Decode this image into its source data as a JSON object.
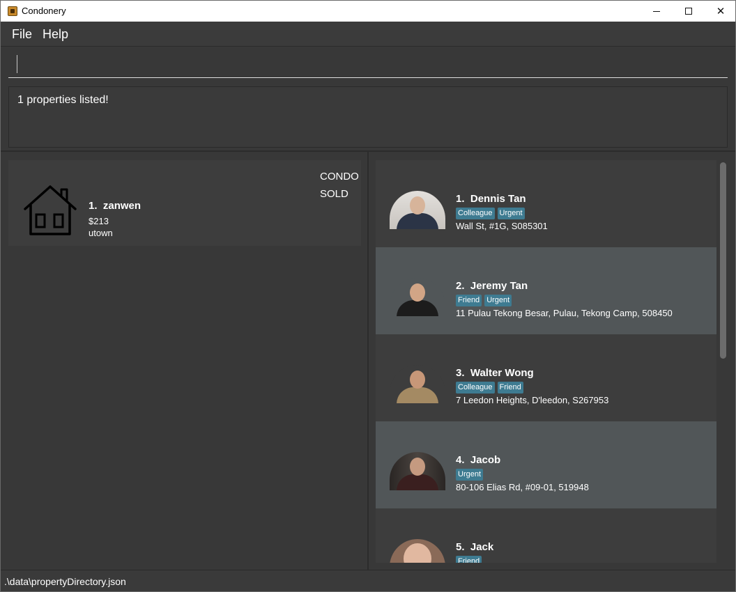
{
  "window": {
    "title": "Condonery",
    "controls": {
      "minimize": "–",
      "maximize": "□",
      "close": "✕"
    }
  },
  "menu": {
    "file": "File",
    "help": "Help"
  },
  "command": {
    "value": ""
  },
  "result": {
    "message": "1 properties listed!"
  },
  "properties": [
    {
      "index": "1.",
      "name": "zanwen",
      "price": "$213",
      "address": "utown",
      "type": "CONDO",
      "status": "SOLD",
      "icon": "house-icon"
    }
  ],
  "persons": [
    {
      "index": "1.",
      "name": "Dennis Tan",
      "tags": [
        "Colleague",
        "Urgent"
      ],
      "address": "Wall St, #1G, S085301"
    },
    {
      "index": "2.",
      "name": "Jeremy Tan",
      "tags": [
        "Friend",
        "Urgent"
      ],
      "address": "11 Pulau Tekong Besar, Pulau, Tekong Camp, 508450"
    },
    {
      "index": "3.",
      "name": "Walter Wong",
      "tags": [
        "Colleague",
        "Friend"
      ],
      "address": "7 Leedon Heights, D'leedon, S267953"
    },
    {
      "index": "4.",
      "name": "Jacob",
      "tags": [
        "Urgent"
      ],
      "address": "80-106 Elias Rd, #09-01, 519948"
    },
    {
      "index": "5.",
      "name": "Jack",
      "tags": [
        "Friend"
      ],
      "address": ""
    }
  ],
  "status": {
    "file_path": ".\\data\\propertyDirectory.json"
  },
  "colors": {
    "background": "#383838",
    "card_dark": "#3d3d3d",
    "card_selected": "#515658",
    "tag": "#3e7b91"
  }
}
